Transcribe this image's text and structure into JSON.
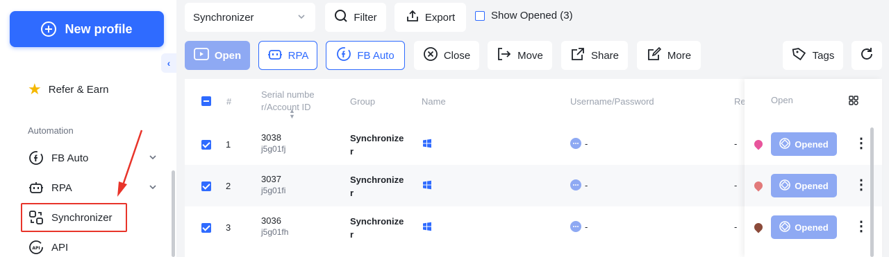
{
  "sidebar": {
    "new_profile_label": "New profile",
    "refer_label": "Refer & Earn",
    "section_automation": "Automation",
    "items": [
      {
        "label": "FB Auto"
      },
      {
        "label": "RPA"
      },
      {
        "label": "Synchronizer"
      },
      {
        "label": "API"
      }
    ]
  },
  "toolbar": {
    "group_select_value": "Synchronizer",
    "filter_label": "Filter",
    "export_label": "Export",
    "show_opened_label": "Show Opened (3)",
    "open_label": "Open",
    "rpa_label": "RPA",
    "fb_auto_label": "FB Auto",
    "close_label": "Close",
    "move_label": "Move",
    "share_label": "Share",
    "more_label": "More",
    "tags_label": "Tags"
  },
  "table": {
    "headers": {
      "index": "#",
      "serial": "Serial number/Account ID",
      "group": "Group",
      "name": "Name",
      "username": "Username/Password",
      "remark": "Re",
      "open": "Open"
    },
    "rows": [
      {
        "index": "1",
        "serial": "3038",
        "account_id": "j5g01fj",
        "group": "Synchronizer",
        "username": "-",
        "remark": "-",
        "open_label": "Opened",
        "dot_color": "#e8559c"
      },
      {
        "index": "2",
        "serial": "3037",
        "account_id": "j5g01fi",
        "group": "Synchronizer",
        "username": "-",
        "remark": "-",
        "open_label": "Opened",
        "dot_color": "#e27a7a"
      },
      {
        "index": "3",
        "serial": "3036",
        "account_id": "j5g01fh",
        "group": "Synchronizer",
        "username": "-",
        "remark": "-",
        "open_label": "Opened",
        "dot_color": "#8b4a3a"
      }
    ]
  },
  "colors": {
    "accent": "#2f6bff",
    "opened_button": "#8ea9f3",
    "highlight_box": "#e8342a"
  }
}
